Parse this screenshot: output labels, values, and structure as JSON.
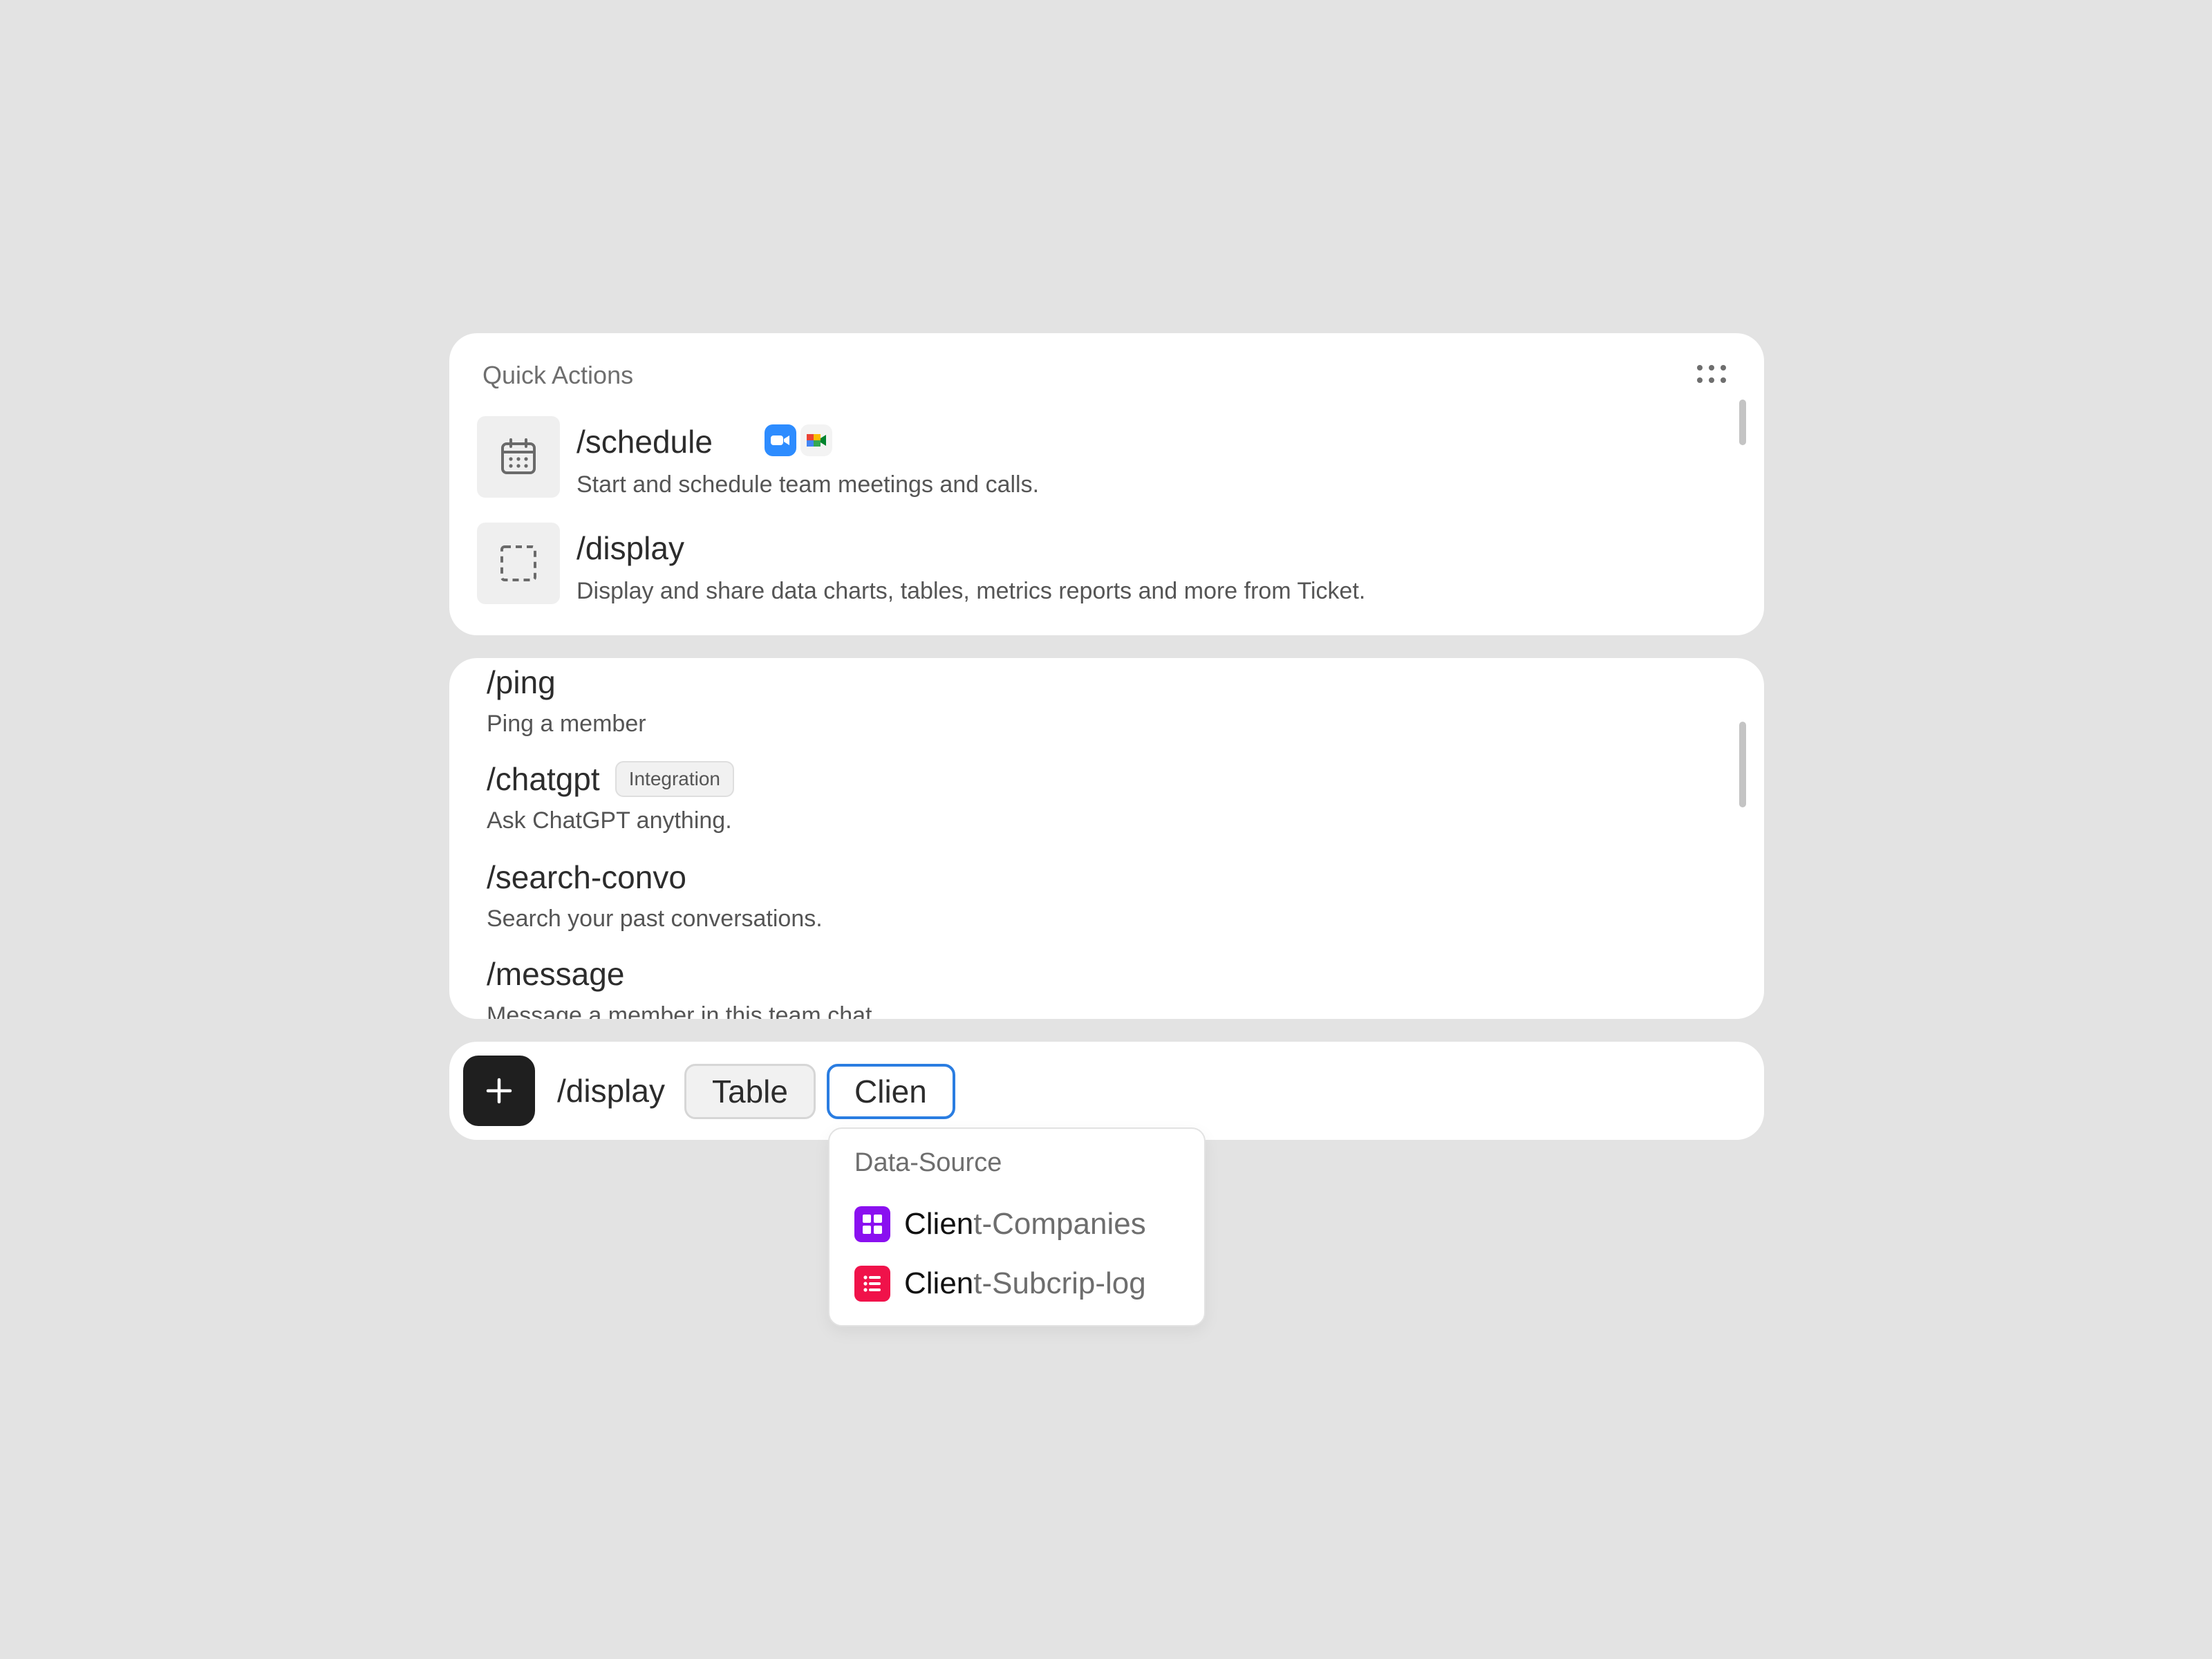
{
  "quick_actions": {
    "title": "Quick Actions",
    "items": [
      {
        "command": "/schedule",
        "description": "Start and schedule team meetings and calls.",
        "icon": "calendar-icon",
        "apps": [
          "zoom-icon",
          "google-meet-icon"
        ]
      },
      {
        "command": "/display",
        "description": "Display and share data charts, tables, metrics reports and more from Ticket.",
        "icon": "dashed-square-icon"
      }
    ]
  },
  "commands": [
    {
      "command": "/ping",
      "description": "Ping a member"
    },
    {
      "command": "/chatgpt",
      "badge": "Integration",
      "description": "Ask ChatGPT anything."
    },
    {
      "command": "/search-convo",
      "description": "Search your past conversations."
    },
    {
      "command": "/message",
      "description": "Message a member in this team chat."
    }
  ],
  "input_bar": {
    "command": "/display",
    "chip": "Table",
    "input_value": "Clien"
  },
  "dropdown": {
    "header": "Data-Source",
    "items": [
      {
        "match": "Clien",
        "rest": "t-Companies",
        "icon": "table-grid-icon",
        "color": "#8a10f0"
      },
      {
        "match": "Clien",
        "rest": "t-Subcrip-log",
        "icon": "list-icon",
        "color": "#f0124a"
      }
    ]
  }
}
